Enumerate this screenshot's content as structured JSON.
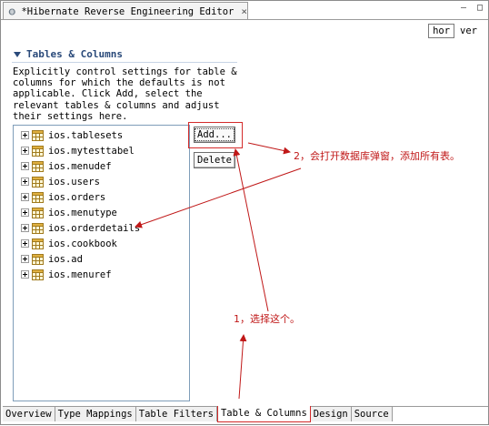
{
  "editor": {
    "title": "*Hibernate Reverse Engineering Editor",
    "close_glyph": "×",
    "minimize_glyph": "–",
    "maximize_glyph": "□"
  },
  "orientation": {
    "hor_label": "hor",
    "ver_label": "ver"
  },
  "section": {
    "title": "Tables & Columns",
    "description": "Explicitly control settings for table & columns for which the defaults is not applicable. Click Add, select the relevant tables & columns and adjust their settings here."
  },
  "tree": {
    "items": [
      {
        "label": "ios.tablesets"
      },
      {
        "label": "ios.mytesttabel"
      },
      {
        "label": "ios.menudef"
      },
      {
        "label": "ios.users"
      },
      {
        "label": "ios.orders"
      },
      {
        "label": "ios.menutype"
      },
      {
        "label": "ios.orderdetails"
      },
      {
        "label": "ios.cookbook"
      },
      {
        "label": "ios.ad"
      },
      {
        "label": "ios.menuref"
      }
    ]
  },
  "buttons": {
    "add_label": "Add...",
    "delete_label": "Delete"
  },
  "annotations": {
    "note_2": "2，会打开数据库弹窗，添加所有表。",
    "note_1": "1，选择这个。",
    "color": "#c01818"
  },
  "bottom_tabs": [
    {
      "label": "Overview"
    },
    {
      "label": "Type Mappings"
    },
    {
      "label": "Table Filters"
    },
    {
      "label": "Table & Columns"
    },
    {
      "label": "Design"
    },
    {
      "label": "Source"
    }
  ],
  "colors": {
    "section_title": "#2a4a7a",
    "tree_border": "#7f9db9",
    "highlight_red": "#d42a2a"
  },
  "icons": {
    "app": "hibernate-app-icon",
    "table": "table-icon",
    "expand": "plus-expander-icon"
  }
}
